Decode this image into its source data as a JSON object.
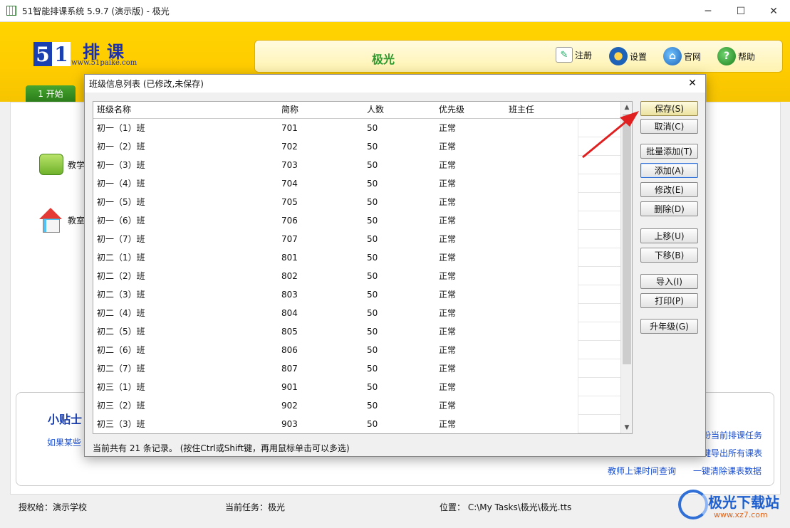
{
  "window": {
    "title": "51智能排课系统 5.9.7 (演示版) - 极光",
    "minimize": "─",
    "maximize": "☐",
    "close": "✕"
  },
  "header": {
    "logo_5": "5",
    "logo_1": "1",
    "logo_text": "排课",
    "logo_url": "www.51paike.com",
    "task_name": "极光",
    "buttons": {
      "register": "注册",
      "settings": "设置",
      "website": "官网",
      "help": "帮助"
    },
    "start_tab": "1 开始"
  },
  "main": {
    "side_items": [
      "教学",
      "教室"
    ],
    "tips_title": "小贴士",
    "tips_link": "如果某些",
    "right_links": [
      "份当前排课任务",
      "键导出所有课表",
      "教师上课时间查询",
      "一键清除课表数据"
    ]
  },
  "statusbar": {
    "licensee": "授权给：演示学校",
    "current_task": "当前任务：极光",
    "location": "位置：  C:\\My Tasks\\极光\\极光.tts"
  },
  "watermark": {
    "text": "极光下载站",
    "url": "www.xz7.com"
  },
  "dialog": {
    "title": "班级信息列表 (已修改,未保存)",
    "close": "✕",
    "columns": [
      "班级名称",
      "简称",
      "人数",
      "优先级",
      "班主任"
    ],
    "rows": [
      [
        "初一（1）班",
        "701",
        "50",
        "正常",
        ""
      ],
      [
        "初一（2）班",
        "702",
        "50",
        "正常",
        ""
      ],
      [
        "初一（3）班",
        "703",
        "50",
        "正常",
        ""
      ],
      [
        "初一（4）班",
        "704",
        "50",
        "正常",
        ""
      ],
      [
        "初一（5）班",
        "705",
        "50",
        "正常",
        ""
      ],
      [
        "初一（6）班",
        "706",
        "50",
        "正常",
        ""
      ],
      [
        "初一（7）班",
        "707",
        "50",
        "正常",
        ""
      ],
      [
        "初二（1）班",
        "801",
        "50",
        "正常",
        ""
      ],
      [
        "初二（2）班",
        "802",
        "50",
        "正常",
        ""
      ],
      [
        "初二（3）班",
        "803",
        "50",
        "正常",
        ""
      ],
      [
        "初二（4）班",
        "804",
        "50",
        "正常",
        ""
      ],
      [
        "初二（5）班",
        "805",
        "50",
        "正常",
        ""
      ],
      [
        "初二（6）班",
        "806",
        "50",
        "正常",
        ""
      ],
      [
        "初二（7）班",
        "807",
        "50",
        "正常",
        ""
      ],
      [
        "初三（1）班",
        "901",
        "50",
        "正常",
        ""
      ],
      [
        "初三（2）班",
        "902",
        "50",
        "正常",
        ""
      ],
      [
        "初三（3）班",
        "903",
        "50",
        "正常",
        ""
      ]
    ],
    "status": "当前共有 21 条记录。 (按住Ctrl或Shift键，再用鼠标单击可以多选)",
    "buttons": {
      "save": "保存(S)",
      "cancel": "取消(C)",
      "batch_add": "批量添加(T)",
      "add": "添加(A)",
      "edit": "修改(E)",
      "delete": "删除(D)",
      "move_up": "上移(U)",
      "move_down": "下移(B)",
      "import": "导入(I)",
      "print": "打印(P)",
      "upgrade": "升年级(G)"
    }
  },
  "colors": {
    "header_yellow": "#ffcc00",
    "task_green": "#2e9a2e",
    "link_blue": "#1a4fd0",
    "annotation_arrow": "#e02020"
  }
}
